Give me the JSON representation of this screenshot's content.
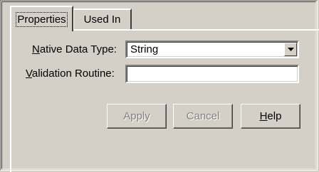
{
  "tabs": [
    {
      "label": "Properties",
      "active": true
    },
    {
      "label": "Used In",
      "active": false
    }
  ],
  "native_data_type": {
    "label_mnemonic": "N",
    "label_rest": "ative Data Type:",
    "value": "String"
  },
  "validation_routine": {
    "label_mnemonic": "V",
    "label_rest": "alidation Routine:",
    "value": ""
  },
  "buttons": {
    "apply": {
      "label": "Apply",
      "enabled": false
    },
    "cancel": {
      "label": "Cancel",
      "enabled": false
    },
    "help": {
      "label_mnemonic": "H",
      "label_rest": "elp",
      "enabled": true
    }
  },
  "colors": {
    "face": "#d4d0c8",
    "highlight": "#ffffff",
    "shadow": "#808080",
    "dark_shadow": "#404040",
    "disabled_text": "#808080"
  },
  "icons": {
    "dropdown": "chevron-down-icon"
  }
}
